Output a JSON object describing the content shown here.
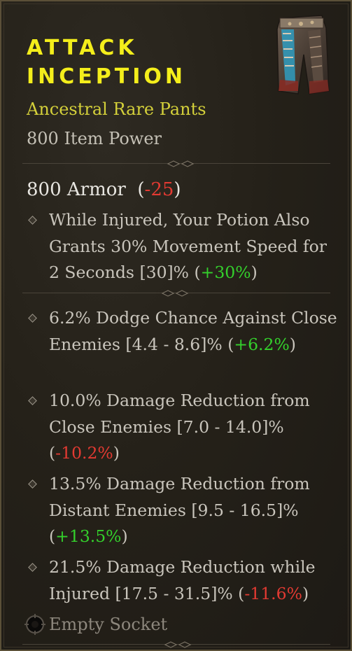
{
  "item": {
    "name_line1": "ATTACK",
    "name_line2": "INCEPTION",
    "type": "Ancestral Rare Pants",
    "power": "800 Item Power",
    "image_icon": "pants-icon"
  },
  "armor": {
    "value": "800 Armor",
    "open": "(",
    "diff": "-25",
    "close": ")"
  },
  "implicit": {
    "text": "While Injured, Your Potion Also Grants 30% Movement Speed for 2 Seconds [30]% (",
    "diff": "+30%",
    "close": ")"
  },
  "affixes": [
    {
      "text": "6.2% Dodge Chance Against Close Enemies [4.4 - 8.6]% (",
      "diff": "+6.2%",
      "close": ")"
    },
    {
      "text": "10.0% Damage Reduction from Close Enemies [7.0 - 14.0]% (",
      "diff": "-10.2%",
      "close": ")"
    },
    {
      "text": "13.5% Damage Reduction from Distant Enemies [9.5 - 16.5]% (",
      "diff": "+13.5%",
      "close": ")"
    },
    {
      "text": "21.5% Damage Reduction while Injured [17.5 - 31.5]% (",
      "diff": "-11.6%",
      "close": ")"
    }
  ],
  "socket": {
    "label": "Empty Socket",
    "icon": "socket-icon"
  },
  "colors": {
    "title": "#f4ee1b",
    "rarity": "#d4d03a",
    "positive": "#34d02c",
    "negative": "#e23a32"
  }
}
